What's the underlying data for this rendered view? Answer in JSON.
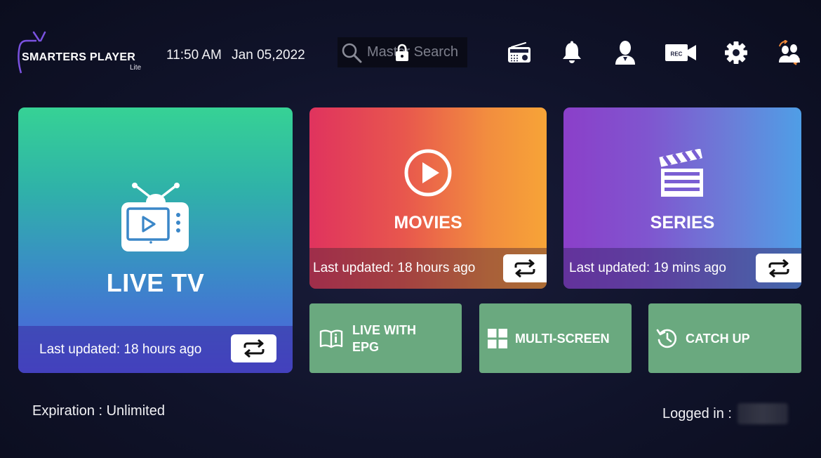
{
  "header": {
    "logo_title": "SMARTERS PLAYER",
    "logo_sub": "Lite",
    "time": "11:50 AM",
    "date": "Jan 05,2022",
    "search_placeholder": "Master Search",
    "icons": [
      "radio-icon",
      "bell-icon",
      "user-icon",
      "rec-camera-icon",
      "gear-icon",
      "switch-user-icon"
    ],
    "rec_label": "REC"
  },
  "tiles": {
    "live": {
      "label": "LIVE TV",
      "updated": "Last updated: 18 hours ago"
    },
    "movies": {
      "label": "MOVIES",
      "updated": "Last updated: 18 hours ago"
    },
    "series": {
      "label": "SERIES",
      "updated": "Last updated: 19 mins ago"
    }
  },
  "small_tiles": {
    "epg": {
      "label": "LIVE WITH EPG"
    },
    "multi": {
      "label": "MULTI-SCREEN"
    },
    "catch": {
      "label": "CATCH UP"
    }
  },
  "footer": {
    "expiration": "Expiration : Unlimited",
    "logged_in": "Logged in :"
  },
  "colors": {
    "small_tile": "#6aa97f",
    "background": "#10132a"
  }
}
